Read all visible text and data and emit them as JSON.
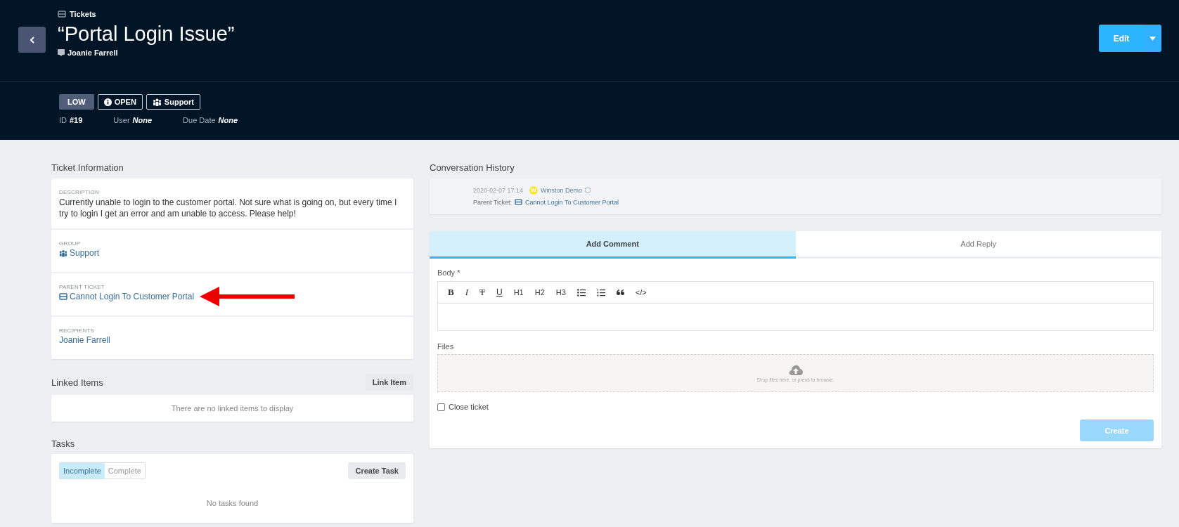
{
  "header": {
    "breadcrumb": "Tickets",
    "title": "“Portal Login Issue”",
    "requester": "Joanie Farrell",
    "edit_button": "Edit"
  },
  "tags": [
    {
      "kind": "priority",
      "label": "LOW"
    },
    {
      "kind": "status",
      "label": "OPEN"
    },
    {
      "kind": "group",
      "label": "Support"
    }
  ],
  "meta": [
    {
      "label": "ID",
      "value": "#19",
      "italic": false
    },
    {
      "label": "User",
      "value": "None",
      "italic": true
    },
    {
      "label": "Due Date",
      "value": "None",
      "italic": true
    }
  ],
  "ticket_information": {
    "title": "Ticket Information",
    "fields": [
      {
        "kind": "text",
        "label": "DESCRIPTION",
        "value": "Currently unable to login to the customer portal. Not sure what is going on, but every time I try to login I get an error and am unable to access. Please help!"
      },
      {
        "kind": "group",
        "label": "GROUP",
        "value": "Support"
      },
      {
        "kind": "ticket",
        "label": "PARENT TICKET",
        "value": "Cannot Login To Customer Portal",
        "annotated": true
      },
      {
        "kind": "link",
        "label": "RECIPIENTS",
        "value": "Joanie Farrell"
      }
    ]
  },
  "linked_items": {
    "title": "Linked Items",
    "button": "Link Item",
    "empty": "There are no linked items to display"
  },
  "tasks": {
    "title": "Tasks",
    "tabs": [
      {
        "label": "Incomplete",
        "selected": true
      },
      {
        "label": "Complete",
        "selected": false
      }
    ],
    "button": "Create Task",
    "empty": "No tasks found"
  },
  "conversation": {
    "title": "Conversation History",
    "entries": [
      {
        "time": "2020-02-07 17:14",
        "avatar": "W",
        "author": "Winston Demo",
        "prefix": "Parent Ticket:",
        "ticket": "Cannot Login To Customer Portal"
      }
    ]
  },
  "composer": {
    "tabs": [
      {
        "label": "Add Comment",
        "selected": true
      },
      {
        "label": "Add Reply",
        "selected": false
      }
    ],
    "body_label": "Body *",
    "toolbar": [
      {
        "kind": "bold",
        "label": "B"
      },
      {
        "kind": "italic",
        "label": "I"
      },
      {
        "kind": "strike",
        "label": "T"
      },
      {
        "kind": "underline",
        "label": "U"
      },
      {
        "kind": "text",
        "label": "H1"
      },
      {
        "kind": "text",
        "label": "H2"
      },
      {
        "kind": "text",
        "label": "H3"
      },
      {
        "kind": "bullet-list"
      },
      {
        "kind": "numbered-list"
      },
      {
        "kind": "quote"
      },
      {
        "kind": "text",
        "label": "</>"
      }
    ],
    "files_label": "Files",
    "dropzone": "Drop files here, or press to browse.",
    "close_ticket": {
      "label": "Close ticket",
      "checked": false
    },
    "create_button": {
      "label": "Create",
      "disabled": true
    }
  }
}
